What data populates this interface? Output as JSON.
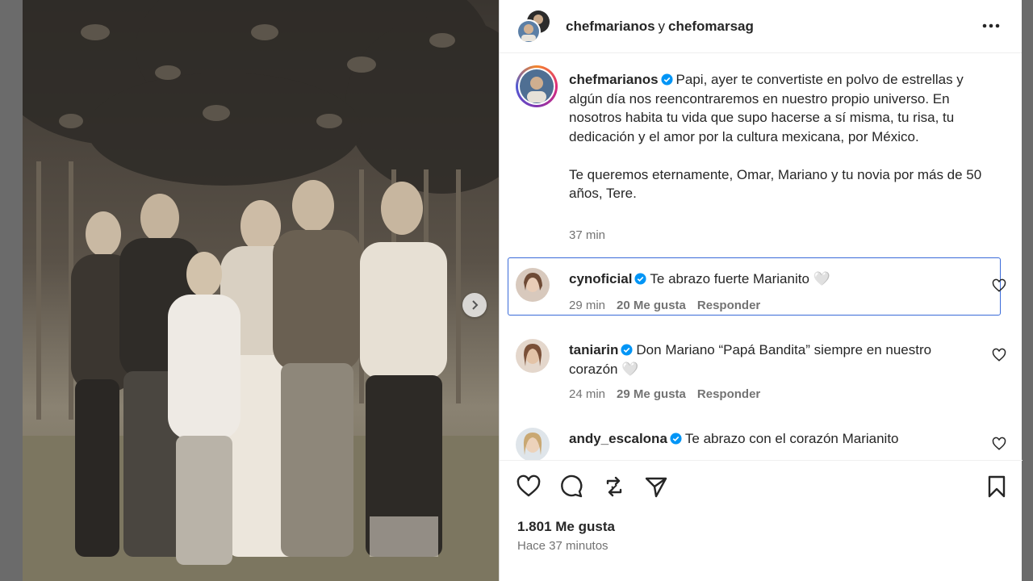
{
  "header": {
    "user1": "chefmarianos",
    "connector": "y",
    "user2": "chefomarsag",
    "more_icon": "more-horizontal-icon"
  },
  "caption": {
    "username": "chefmarianos",
    "text_p1": "Papi, ayer te convertiste en polvo de estrellas y algún día nos reencontraremos en nuestro propio universo. En nosotros habita tu vida que supo hacerse a sí misma, tu risa, tu dedicación y el amor por la cultura mexicana, por México.",
    "text_p2": "Te queremos eternamente, Omar, Mariano y tu novia por más de 50 años, Tere.",
    "time": "37 min"
  },
  "comments": [
    {
      "username": "cynoficial",
      "text": "Te abrazo fuerte Marianito 🤍",
      "time": "29 min",
      "likes": "20 Me gusta",
      "reply": "Responder"
    },
    {
      "username": "taniarin",
      "text": "Don Mariano “Papá Bandita” siempre en nuestro corazón 🤍",
      "time": "24 min",
      "likes": "29 Me gusta",
      "reply": "Responder"
    },
    {
      "username": "andy_escalona",
      "text": "Te abrazo con el corazón Marianito",
      "time": "",
      "likes": "",
      "reply": ""
    }
  ],
  "footer": {
    "likes": "1.801 Me gusta",
    "ago": "Hace 37 minutos"
  },
  "colors": {
    "accent_border": "#3a6bd9",
    "verified": "#0095f6",
    "muted": "#737373"
  }
}
